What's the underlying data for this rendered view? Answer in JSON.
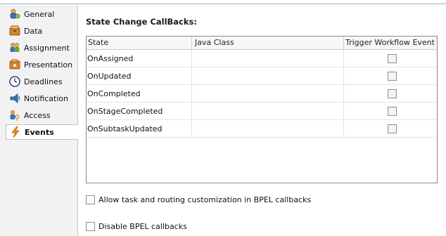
{
  "sidebar": {
    "items": [
      {
        "label": "General",
        "icon": "general-icon"
      },
      {
        "label": "Data",
        "icon": "data-icon"
      },
      {
        "label": "Assignment",
        "icon": "assignment-icon"
      },
      {
        "label": "Presentation",
        "icon": "presentation-icon"
      },
      {
        "label": "Deadlines",
        "icon": "deadlines-icon"
      },
      {
        "label": "Notification",
        "icon": "notification-icon"
      },
      {
        "label": "Access",
        "icon": "access-icon"
      },
      {
        "label": "Events",
        "icon": "lightning-icon",
        "active": true
      }
    ]
  },
  "main": {
    "title": "State Change CallBacks:",
    "table": {
      "columns": [
        "State",
        "Java Class",
        "Trigger Workflow Event"
      ],
      "rows": [
        {
          "state": "OnAssigned",
          "java_class": "",
          "trigger": false
        },
        {
          "state": "OnUpdated",
          "java_class": "",
          "trigger": false
        },
        {
          "state": "OnCompleted",
          "java_class": "",
          "trigger": false
        },
        {
          "state": "OnStageCompleted",
          "java_class": "",
          "trigger": false
        },
        {
          "state": "OnSubtaskUpdated",
          "java_class": "",
          "trigger": false
        }
      ]
    },
    "options": {
      "allow_customization": {
        "label": "Allow task and routing customization in BPEL callbacks",
        "checked": false
      },
      "disable_callbacks": {
        "label": "Disable BPEL callbacks",
        "checked": false
      }
    }
  }
}
